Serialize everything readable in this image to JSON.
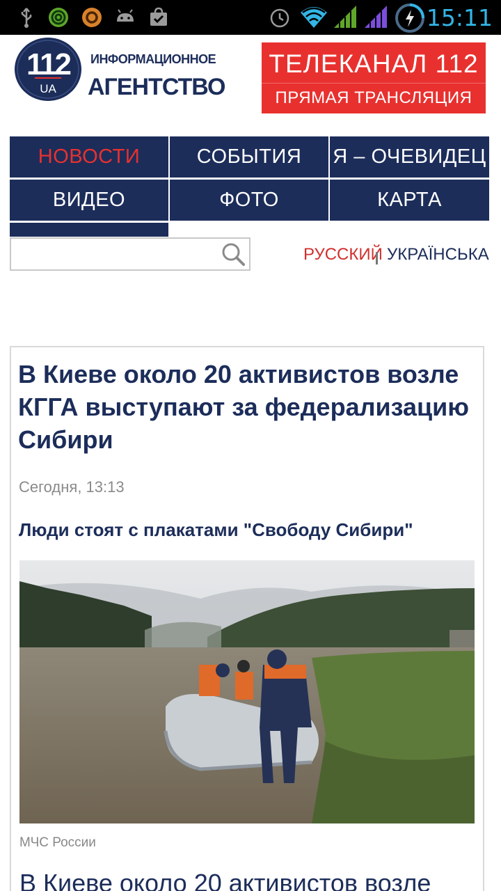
{
  "statusbar": {
    "time": "15:11",
    "icons": [
      "usb-icon",
      "at-icon",
      "ubuntu-icon",
      "android-icon",
      "store-icon",
      "alarm-icon",
      "wifi-icon",
      "signal-icon",
      "signal-icon",
      "battery-charging-icon"
    ]
  },
  "header": {
    "logo_number": "112",
    "logo_sub": "UA",
    "agency_line1": "ИНФОРМАЦИОННОЕ",
    "agency_line2": "АГЕНТСТВО",
    "tv_title": "ТЕЛЕКАНАЛ 112",
    "tv_subtitle": "ПРЯМАЯ ТРАНСЛЯЦИЯ"
  },
  "nav": {
    "items": [
      {
        "label": "НОВОСТИ",
        "active": true
      },
      {
        "label": "СОБЫТИЯ"
      },
      {
        "label": "Я – ОЧЕВИДЕЦ"
      },
      {
        "label": "ВИДЕО"
      },
      {
        "label": "ФОТО"
      },
      {
        "label": "КАРТА"
      }
    ]
  },
  "search": {
    "placeholder": "",
    "value": ""
  },
  "languages": {
    "russian": "РУССКИЙ",
    "ukrainian": "УКРАЇНСЬКА"
  },
  "article": {
    "headline": "В Киеве около 20 активистов возле КГГА выступают за федерализацию Сибири",
    "date": "Сегодня, 13:13",
    "lead": "Люди стоят с плакатами \"Свободу Сибири\"",
    "photo_credit": "МЧС России",
    "body_start": "В Киеве около 20 активистов возле"
  },
  "colors": {
    "navy": "#1c2d5a",
    "red": "#e8312f",
    "status_blue": "#33b5e5"
  }
}
